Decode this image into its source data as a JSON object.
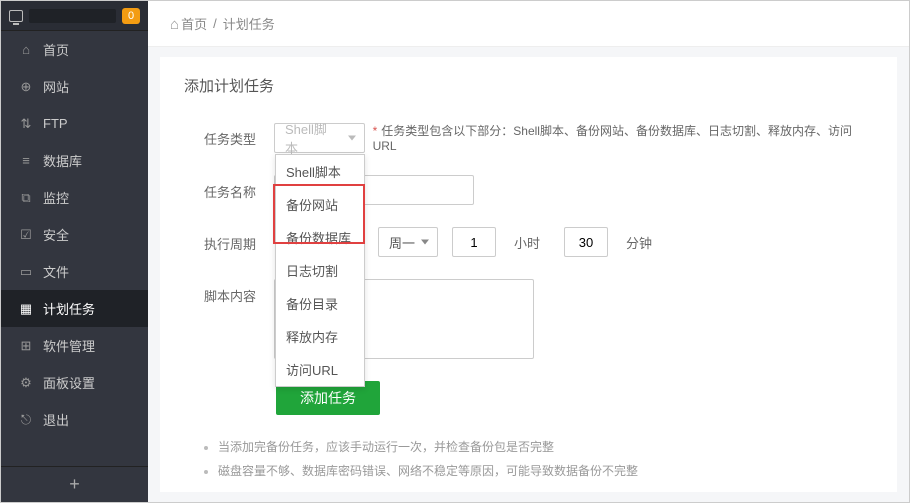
{
  "sidebar": {
    "badge": "0",
    "items": [
      {
        "icon": "home",
        "label": "首页"
      },
      {
        "icon": "globe",
        "label": "网站"
      },
      {
        "icon": "ftp",
        "label": "FTP"
      },
      {
        "icon": "db",
        "label": "数据库"
      },
      {
        "icon": "chart",
        "label": "监控"
      },
      {
        "icon": "shield",
        "label": "安全"
      },
      {
        "icon": "folder",
        "label": "文件"
      },
      {
        "icon": "calendar",
        "label": "计划任务"
      },
      {
        "icon": "apps",
        "label": "软件管理"
      },
      {
        "icon": "gear",
        "label": "面板设置"
      },
      {
        "icon": "exit",
        "label": "退出"
      }
    ]
  },
  "breadcrumb": {
    "home": "首页",
    "sep": "/",
    "current": "计划任务"
  },
  "page": {
    "title": "添加计划任务",
    "labels": {
      "task_type": "任务类型",
      "task_name": "任务名称",
      "period": "执行周期",
      "script": "脚本内容"
    },
    "type_select_value": "Shell脚本",
    "type_hint": "任务类型包含以下部分：Shell脚本、备份网站、备份数据库、日志切割、释放内存、访问URL",
    "type_dropdown": [
      "Shell脚本",
      "备份网站",
      "备份数据库",
      "日志切割",
      "备份目录",
      "释放内存",
      "访问URL"
    ],
    "task_name_value": "",
    "period": {
      "day_select": "周一",
      "hour_value": "1",
      "hour_unit": "小时",
      "minute_value": "30",
      "minute_unit": "分钟"
    },
    "script_value": "",
    "submit_label": "添加任务",
    "tips": [
      "当添加完备份任务，应该手动运行一次，并检查备份包是否完整",
      "磁盘容量不够、数据库密码错误、网络不稳定等原因，可能导致数据备份不完整"
    ]
  }
}
